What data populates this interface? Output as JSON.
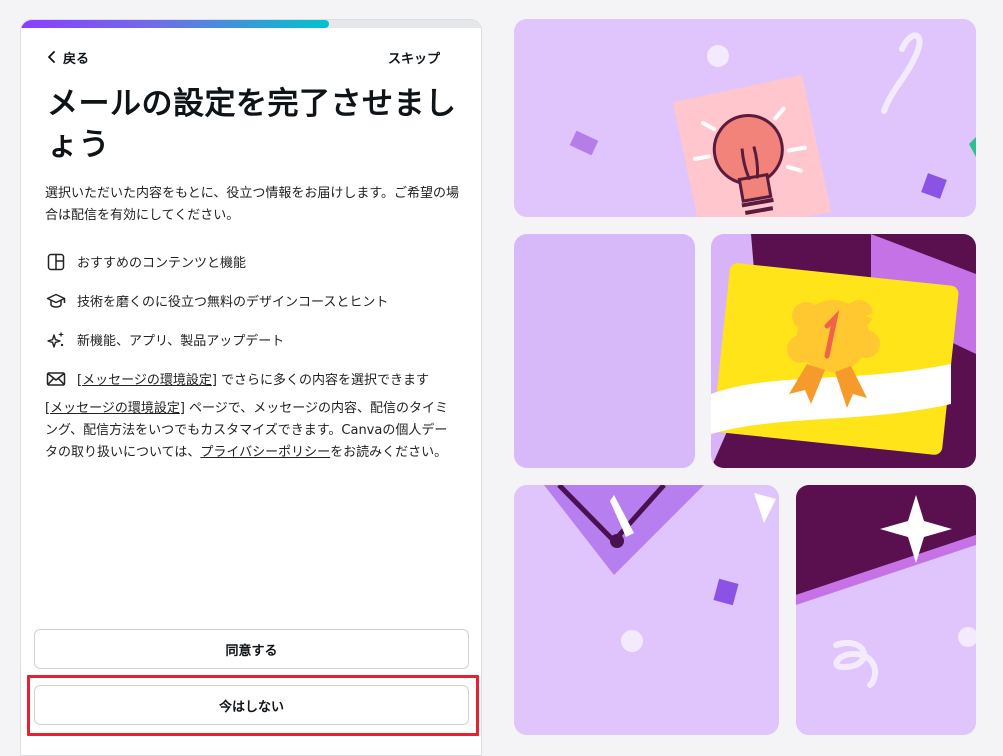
{
  "progress": {
    "fraction": 0.67
  },
  "nav": {
    "back_label": "戻る",
    "skip_label": "スキップ"
  },
  "title": "メールの設定を完了させましょう",
  "intro": "選択いただいた内容をもとに、役立つ情報をお届けします。ご希望の場合は配信を有効にしてください。",
  "features": [
    {
      "icon": "layout-icon",
      "text": "おすすめのコンテンツと機能"
    },
    {
      "icon": "graduation-cap-icon",
      "text": "技術を磨くのに役立つ無料のデザインコースとヒント"
    },
    {
      "icon": "sparkles-icon",
      "text": "新機能、アプリ、製品アップデート"
    },
    {
      "icon": "envelope-icon",
      "pre": "[",
      "link": "メッセージの環境設定",
      "post": "] でさらに多くの内容を選択できます"
    }
  ],
  "note": {
    "pre": "[",
    "link1": "メッセージの環境設定",
    "mid": "] ページで、メッセージの内容、配信のタイミング、配信方法をいつでもカスタマイズできます。Canvaの個人データの取り扱いについては、",
    "link2": "プライバシーポリシー",
    "post": "をお読みください。"
  },
  "buttons": {
    "agree": "同意する",
    "later": "今はしない"
  },
  "colors": {
    "accent_purple": "#8b3dff",
    "accent_teal": "#00c4cc",
    "tile_lilac": "#dfc5fb",
    "highlight_red": "#e8202f"
  }
}
